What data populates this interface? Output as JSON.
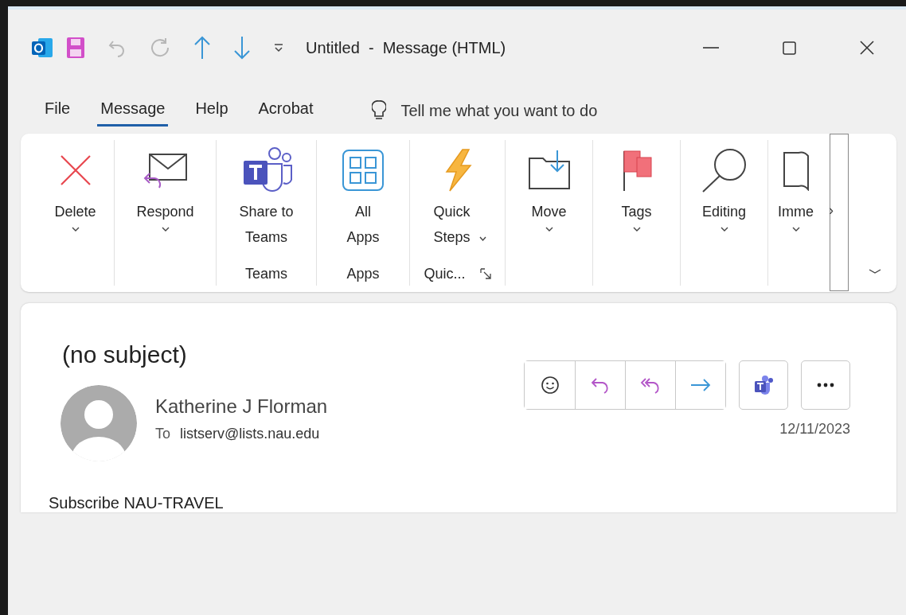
{
  "window": {
    "title": "Untitled  -  Message (HTML)",
    "quick_access": [
      {
        "kind": "save"
      },
      {
        "kind": "undo",
        "disabled": true
      },
      {
        "kind": "redo",
        "disabled": true
      },
      {
        "kind": "up",
        "disabled": false
      },
      {
        "kind": "down",
        "disabled": false
      },
      {
        "kind": "customize"
      }
    ]
  },
  "menu": {
    "tabs": [
      {
        "label": "File",
        "selected": false
      },
      {
        "label": "Message",
        "selected": true
      },
      {
        "label": "Help",
        "selected": false
      },
      {
        "label": "Acrobat",
        "selected": false
      }
    ],
    "search": {
      "placeholder": "Tell me what you want to do"
    }
  },
  "ribbon": {
    "groups": [
      {
        "commands": [
          {
            "label": "Delete",
            "kind": "delete",
            "dropdown": true
          }
        ]
      },
      {
        "commands": [
          {
            "label": "Respond",
            "kind": "respond",
            "dropdown": true
          }
        ]
      },
      {
        "label": "Teams",
        "commands": [
          {
            "label": "Share to Teams",
            "kind": "teams",
            "dropdown": false
          }
        ]
      },
      {
        "label": "Apps",
        "commands": [
          {
            "label": "All Apps",
            "kind": "apps",
            "dropdown": false
          }
        ]
      },
      {
        "label": "Quic...",
        "launcher": true,
        "commands": [
          {
            "label": "Quick Steps",
            "kind": "quick",
            "dropdown": true
          }
        ]
      },
      {
        "commands": [
          {
            "label": "Move",
            "kind": "move",
            "dropdown": true
          }
        ]
      },
      {
        "commands": [
          {
            "label": "Tags",
            "kind": "tags",
            "dropdown": true
          }
        ]
      },
      {
        "commands": [
          {
            "label": "Editing",
            "kind": "editing",
            "dropdown": true
          }
        ]
      },
      {
        "commands": [
          {
            "label": "Imme",
            "kind": "reader",
            "dropdown": true
          }
        ]
      }
    ],
    "scroll_right": "›"
  },
  "message": {
    "subject": "(no subject)",
    "sender": "Katherine J Florman",
    "to_label": "To",
    "recipient": "listserv@lists.nau.edu",
    "date": "12/11/2023",
    "body": "Subscribe NAU-TRAVEL",
    "actions": [
      {
        "kind": "emoji",
        "grouped": true
      },
      {
        "kind": "reply",
        "grouped": true
      },
      {
        "kind": "reply-all",
        "grouped": true
      },
      {
        "kind": "forward",
        "grouped": true
      },
      {
        "kind": "teams",
        "grouped": false
      },
      {
        "kind": "more",
        "grouped": false
      }
    ]
  }
}
